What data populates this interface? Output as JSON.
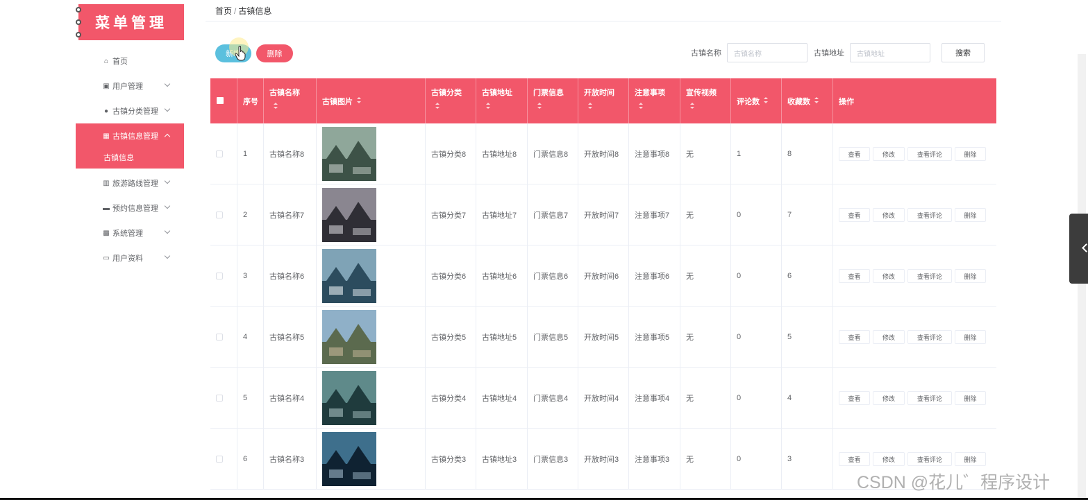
{
  "sidebar": {
    "logo": "菜单管理",
    "items": [
      {
        "label": "首页",
        "icon": "home-icon"
      },
      {
        "label": "用户管理",
        "icon": "user-icon"
      },
      {
        "label": "古镇分类管理",
        "icon": "location-icon"
      },
      {
        "label": "古镇信息管理",
        "icon": "grid-icon"
      },
      {
        "label": "旅游路线管理",
        "icon": "chart-icon"
      },
      {
        "label": "预约信息管理",
        "icon": "monitor-icon"
      },
      {
        "label": "系统管理",
        "icon": "apps-icon"
      },
      {
        "label": "用户资料",
        "icon": "card-icon"
      }
    ],
    "submenu": {
      "label": "古镇信息"
    }
  },
  "breadcrumb": {
    "home": "首页",
    "separator": "/",
    "current": "古镇信息"
  },
  "toolbar": {
    "add_label": "新增",
    "delete_label": "删除"
  },
  "search": {
    "name_label": "古镇名称",
    "name_placeholder": "古镇名称",
    "address_label": "古镇地址",
    "address_placeholder": "古镇地址",
    "button_label": "搜索"
  },
  "table": {
    "headers": {
      "index": "序号",
      "name": "古镇名称",
      "image": "古镇图片",
      "category": "古镇分类",
      "address": "古镇地址",
      "ticket": "门票信息",
      "open_time": "开放时间",
      "notes": "注意事项",
      "video": "宣传视频",
      "comments": "评论数",
      "favorites": "收藏数",
      "actions": "操作"
    },
    "action_labels": {
      "view": "查看",
      "edit": "修改",
      "view_comments": "查看评论",
      "delete": "删除"
    },
    "rows": [
      {
        "index": "1",
        "name": "古镇名称8",
        "category": "古镇分类8",
        "address": "古镇地址8",
        "ticket": "门票信息8",
        "open_time": "开放时间8",
        "notes": "注意事项8",
        "video": "无",
        "comments": "1",
        "favorites": "8"
      },
      {
        "index": "2",
        "name": "古镇名称7",
        "category": "古镇分类7",
        "address": "古镇地址7",
        "ticket": "门票信息7",
        "open_time": "开放时间7",
        "notes": "注意事项7",
        "video": "无",
        "comments": "0",
        "favorites": "7"
      },
      {
        "index": "3",
        "name": "古镇名称6",
        "category": "古镇分类6",
        "address": "古镇地址6",
        "ticket": "门票信息6",
        "open_time": "开放时间6",
        "notes": "注意事项6",
        "video": "无",
        "comments": "0",
        "favorites": "6"
      },
      {
        "index": "4",
        "name": "古镇名称5",
        "category": "古镇分类5",
        "address": "古镇地址5",
        "ticket": "门票信息5",
        "open_time": "开放时间5",
        "notes": "注意事项5",
        "video": "无",
        "comments": "0",
        "favorites": "5"
      },
      {
        "index": "5",
        "name": "古镇名称4",
        "category": "古镇分类4",
        "address": "古镇地址4",
        "ticket": "门票信息4",
        "open_time": "开放时间4",
        "notes": "注意事项4",
        "video": "无",
        "comments": "0",
        "favorites": "4"
      },
      {
        "index": "6",
        "name": "古镇名称3",
        "category": "古镇分类3",
        "address": "古镇地址3",
        "ticket": "门票信息3",
        "open_time": "开放时间3",
        "notes": "注意事项3",
        "video": "无",
        "comments": "0",
        "favorites": "3"
      }
    ]
  },
  "watermark": "CSDN @花儿゛程序设计",
  "colors": {
    "accent": "#f2576a",
    "add_button": "#5bc0de"
  }
}
